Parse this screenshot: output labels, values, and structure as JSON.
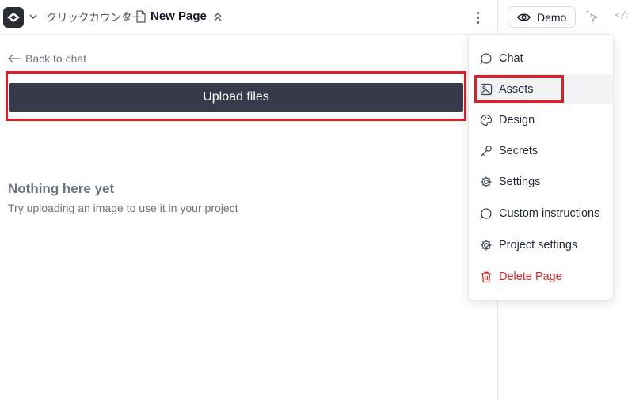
{
  "header": {
    "project_name": "クリックカウンター",
    "separator": "/",
    "page_title": "New Page"
  },
  "preview_toolbar": {
    "demo_label": "Demo",
    "code_label": "</>"
  },
  "main": {
    "back_label": "Back to chat",
    "upload_label": "Upload files",
    "empty_title": "Nothing here yet",
    "empty_subtitle": "Try uploading an image to use it in your project"
  },
  "menu": {
    "items": [
      {
        "label": "Chat",
        "icon": "chat-bubble-icon"
      },
      {
        "label": "Assets",
        "icon": "image-icon"
      },
      {
        "label": "Design",
        "icon": "palette-icon"
      },
      {
        "label": "Secrets",
        "icon": "key-icon"
      },
      {
        "label": "Settings",
        "icon": "gear-icon"
      },
      {
        "label": "Custom instructions",
        "icon": "chat-bubble-icon"
      },
      {
        "label": "Project settings",
        "icon": "gear-icon"
      },
      {
        "label": "Delete Page",
        "icon": "trash-icon"
      }
    ]
  },
  "colors": {
    "upload_button_bg": "#363a4b",
    "highlight_red": "#e01e25",
    "danger": "#dc2626"
  }
}
